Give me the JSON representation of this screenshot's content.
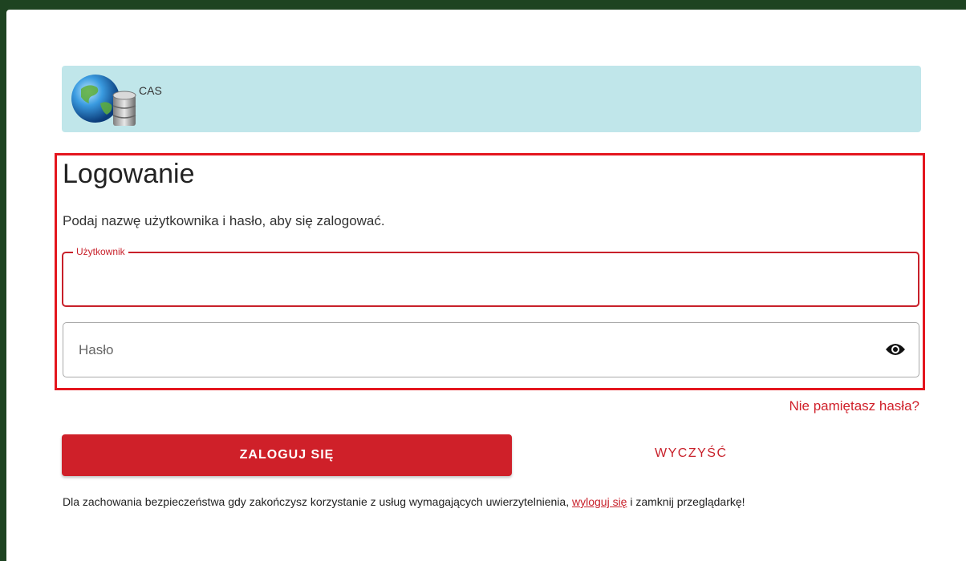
{
  "banner": {
    "app_name": "CAS",
    "logo_icon": "globe-database-icon"
  },
  "login": {
    "title": "Logowanie",
    "subtitle": "Podaj nazwę użytkownika i hasło, aby się zalogować.",
    "username": {
      "label": "Użytkownik",
      "value": ""
    },
    "password": {
      "placeholder": "Hasło",
      "value": "",
      "toggle_icon": "eye-icon"
    },
    "forgot_link": "Nie pamiętasz hasła?",
    "submit_label": "ZALOGUJ SIĘ",
    "clear_label": "WYCZYŚĆ"
  },
  "notice": {
    "before": "Dla zachowania bezpieczeństwa gdy zakończysz korzystanie z usług wymagających uwierzytelnienia, ",
    "link": "wyloguj się",
    "after": " i zamknij przeglądarkę!"
  },
  "colors": {
    "accent": "#cf2029",
    "highlight_border": "#e4161e",
    "banner_bg": "#c0e6ea",
    "page_bg": "#1e4321"
  }
}
